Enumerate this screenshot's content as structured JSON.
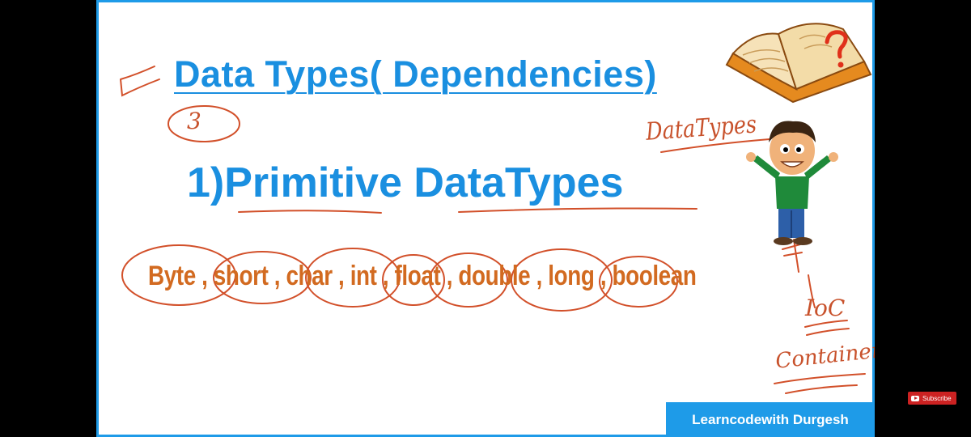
{
  "slide": {
    "title": "Data Types( Dependencies)",
    "subtitle": "1)Primitive DataTypes",
    "primitive_types": "Byte , short , char , int , float , double , long , boolean",
    "branding": "Learncodewith Durgesh"
  },
  "annotations": {
    "circled_number": "3",
    "datatypes_note": "DataTypes",
    "ioc_note": "IoC",
    "container_note": "Container"
  },
  "subscribe_button": {
    "label": "Subscribe",
    "icon": "youtube-play-icon"
  },
  "illustrations": {
    "book": "open-book-question-icon",
    "character": "cartoon-boy-icon"
  },
  "colors": {
    "title_blue": "#1a8fe0",
    "types_orange": "#d26a20",
    "ink_red": "#d2502a",
    "brand_bar": "#1e9be8",
    "subscribe_red": "#cc2222"
  }
}
